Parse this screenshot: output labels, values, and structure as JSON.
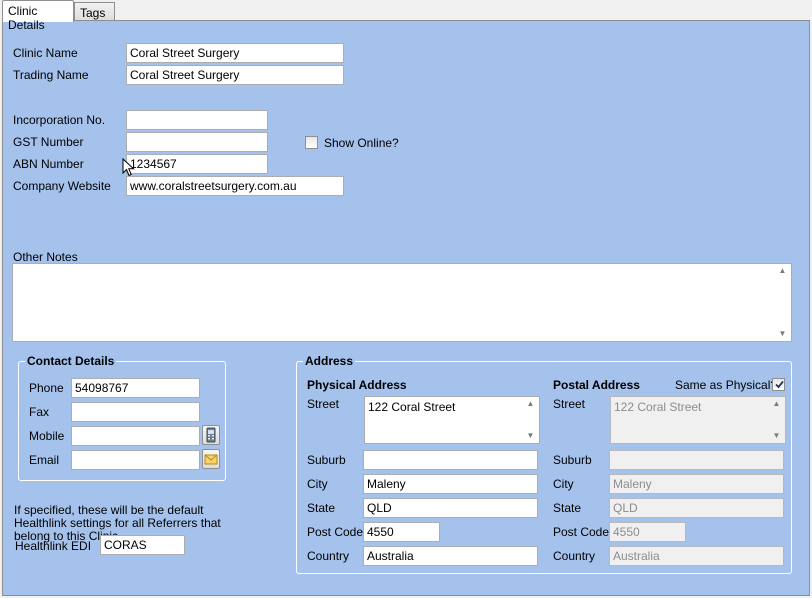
{
  "tabs": [
    {
      "label": "Clinic Details"
    },
    {
      "label": "Tags"
    }
  ],
  "clinic": {
    "clinic_name_label": "Clinic Name",
    "clinic_name": "Coral Street Surgery",
    "trading_name_label": "Trading Name",
    "trading_name": "Coral Street Surgery",
    "incorporation_label": "Incorporation No.",
    "incorporation": "",
    "gst_label": "GST Number",
    "gst": "",
    "show_online_label": "Show Online?",
    "show_online": false,
    "abn_label": "ABN Number",
    "abn": "1234567",
    "website_label": "Company Website",
    "website": "www.coralstreetsurgery.com.au",
    "other_notes_label": "Other Notes",
    "other_notes": ""
  },
  "contact": {
    "title": "Contact Details",
    "phone_label": "Phone",
    "phone": "54098767",
    "fax_label": "Fax",
    "fax": "",
    "mobile_label": "Mobile",
    "mobile": "",
    "email_label": "Email",
    "email": ""
  },
  "healthlink": {
    "note": "If specified, these will be the default Healthlink settings for all Referrers that belong to this Clinic",
    "edi_label": "Healthlink EDI",
    "edi": "CORAS"
  },
  "address": {
    "title": "Address",
    "physical": {
      "title": "Physical Address",
      "street_label": "Street",
      "street": "122 Coral Street",
      "suburb_label": "Suburb",
      "suburb": "",
      "city_label": "City",
      "city": "Maleny",
      "state_label": "State",
      "state": "QLD",
      "postcode_label": "Post Code",
      "postcode": "4550",
      "country_label": "Country",
      "country": "Australia"
    },
    "postal": {
      "title": "Postal Address",
      "same_label": "Same as Physical?",
      "same_as_physical": true,
      "street_label": "Street",
      "street": "122 Coral Street",
      "suburb_label": "Suburb",
      "suburb": "",
      "city_label": "City",
      "city": "Maleny",
      "state_label": "State",
      "state": "QLD",
      "postcode_label": "Post Code",
      "postcode": "4550",
      "country_label": "Country",
      "country": "Australia"
    }
  },
  "icons": {
    "mobile_button": "phone-icon",
    "email_button": "envelope-icon",
    "cursor": "mouse-cursor-icon"
  },
  "colors": {
    "panel_background": "#a5c2ec",
    "group_border": "#ffffff",
    "disabled_field": "#f0f0f0"
  }
}
